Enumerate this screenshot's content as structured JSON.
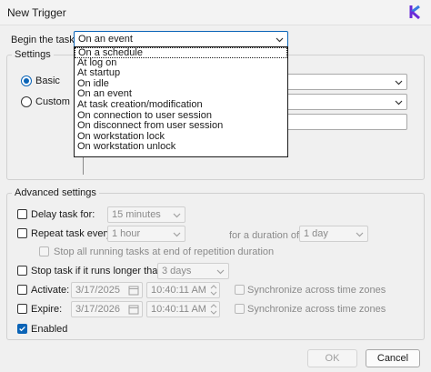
{
  "window": {
    "title": "New Trigger",
    "app_icon": "task-scheduler-logo"
  },
  "begin_task": {
    "label": "Begin the task:",
    "selected": "On an event",
    "options": [
      "On a schedule",
      "At log on",
      "At startup",
      "On idle",
      "On an event",
      "At task creation/modification",
      "On connection to user session",
      "On disconnect from user session",
      "On workstation lock",
      "On workstation unlock"
    ]
  },
  "settings": {
    "title": "Settings",
    "basic_label": "Basic",
    "custom_label": "Custom"
  },
  "advanced": {
    "title": "Advanced settings",
    "delay_label": "Delay task for:",
    "delay_value": "15 minutes",
    "repeat_label": "Repeat task every:",
    "repeat_value": "1 hour",
    "duration_label": "for a duration of:",
    "duration_value": "1 day",
    "stop_running_label": "Stop all running tasks at end of repetition duration",
    "stop_longer_label": "Stop task if it runs longer than:",
    "stop_longer_value": "3 days",
    "activate_label": "Activate:",
    "activate_date": "3/17/2025",
    "activate_time": "10:40:11 AM",
    "expire_label": "Expire:",
    "expire_date": "3/17/2026",
    "expire_time": "10:40:11 AM",
    "sync_label": "Synchronize across time zones",
    "enabled_label": "Enabled"
  },
  "buttons": {
    "ok": "OK",
    "cancel": "Cancel"
  },
  "colors": {
    "accent": "#0a64b7",
    "window_bg": "#f0f0f0"
  }
}
